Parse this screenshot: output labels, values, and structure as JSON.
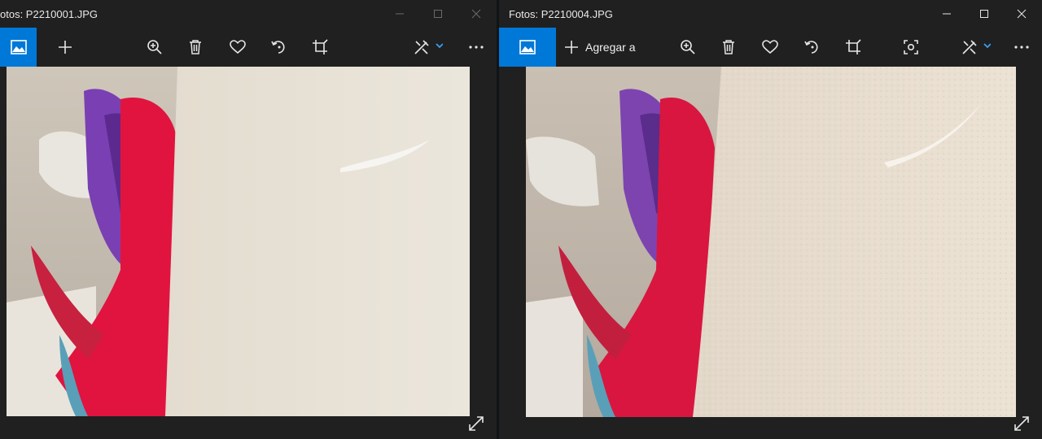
{
  "left_window": {
    "title": "otos: P2210001.JPG",
    "toolbar": [
      "image-icon",
      "add-icon",
      "zoom-in-icon",
      "delete-icon",
      "favorite-icon",
      "rotate-icon",
      "crop-icon",
      "edit-create-icon",
      "more-icon"
    ]
  },
  "right_window": {
    "title": "Fotos: P2210004.JPG",
    "add_label": "Agregar a",
    "toolbar": [
      "image-icon",
      "add-icon",
      "zoom-in-icon",
      "delete-icon",
      "favorite-icon",
      "rotate-icon",
      "crop-icon",
      "auto-enhance-icon",
      "edit-create-icon",
      "more-icon"
    ]
  },
  "colors": {
    "accent": "#0078d7",
    "chrome": "#202020",
    "icon": "#e6e6e6"
  }
}
